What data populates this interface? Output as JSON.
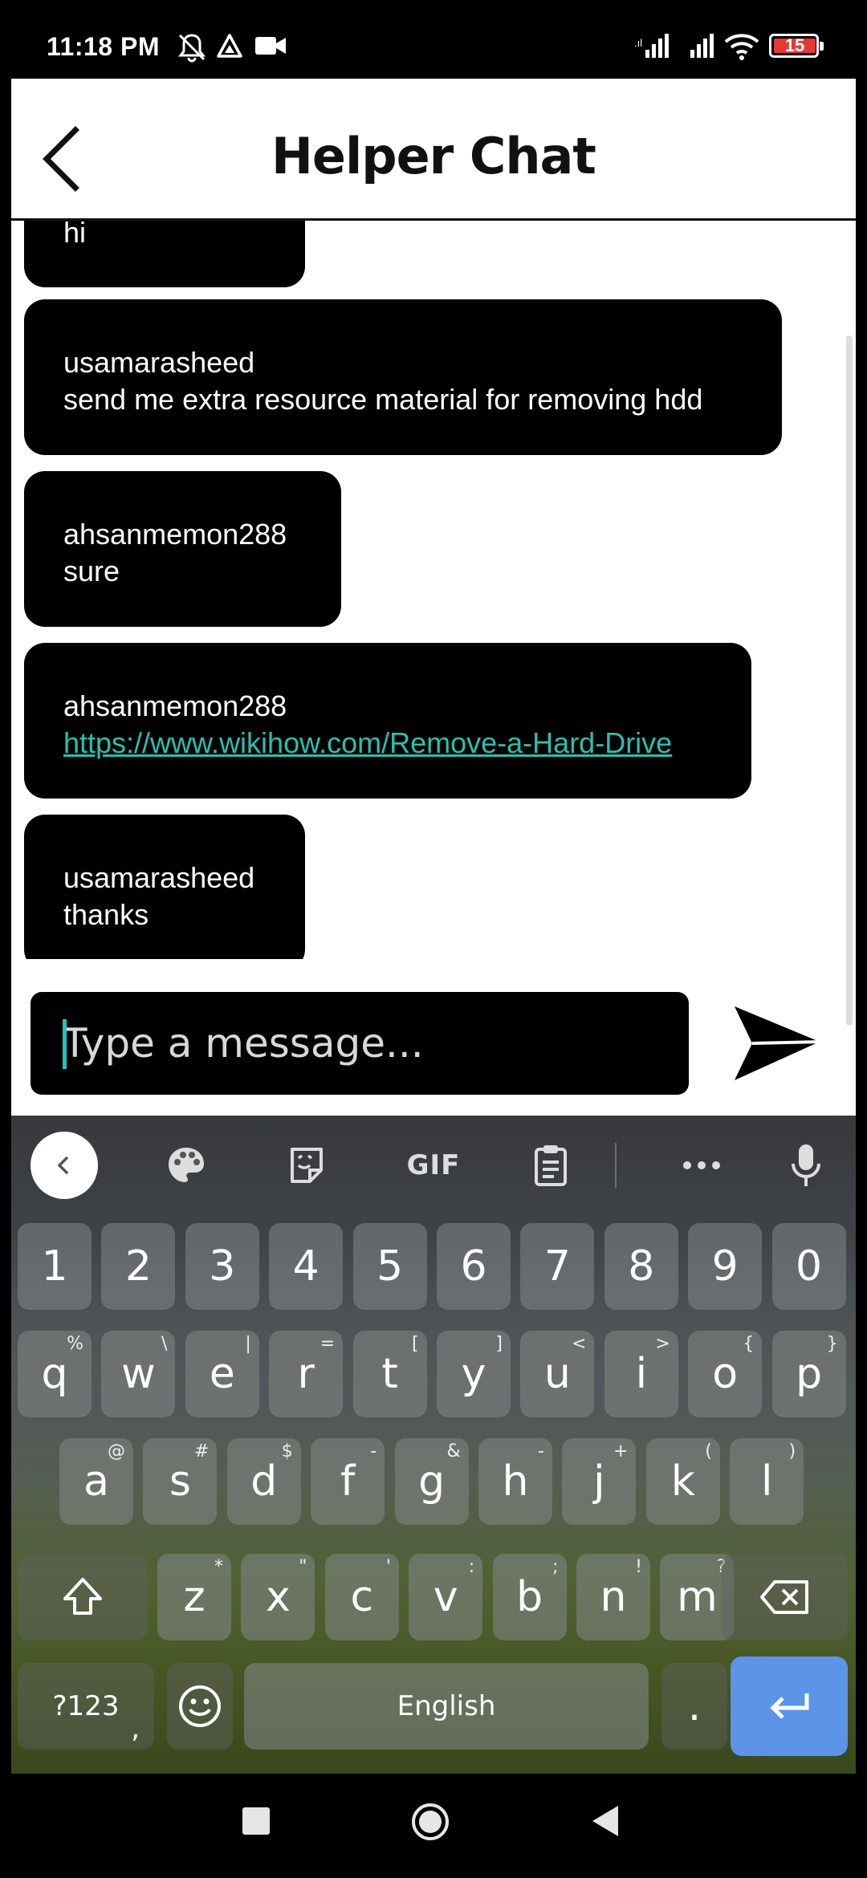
{
  "status_bar": {
    "time": "11:18 PM",
    "battery_level": "15",
    "icons": [
      "mute-icon",
      "drive-icon",
      "video-icon",
      "signal-icon",
      "signal-icon",
      "wifi-icon",
      "battery-icon"
    ]
  },
  "header": {
    "title": "Helper Chat",
    "back_icon": "chevron-left-icon"
  },
  "messages": [
    {
      "sender": "",
      "text": "hi",
      "link": false
    },
    {
      "sender": "usamarasheed",
      "text": "send me extra resource material for removing hdd",
      "link": false
    },
    {
      "sender": "ahsanmemon288",
      "text": "sure",
      "link": false
    },
    {
      "sender": "ahsanmemon288",
      "text": "https://www.wikihow.com/Remove-a-Hard-Drive",
      "link": true
    },
    {
      "sender": "usamarasheed",
      "text": "thanks",
      "link": false
    }
  ],
  "composer": {
    "placeholder": "Type a message...",
    "value": "",
    "send_icon": "send-icon"
  },
  "keyboard": {
    "toolbar": {
      "icons": [
        "chevron-left-icon",
        "palette-icon",
        "sticker-icon",
        "gif-icon",
        "clipboard-icon",
        "more-icon",
        "mic-icon"
      ],
      "gif_label": "GIF"
    },
    "number_row": [
      "1",
      "2",
      "3",
      "4",
      "5",
      "6",
      "7",
      "8",
      "9",
      "0"
    ],
    "row1": [
      {
        "k": "q",
        "h": "%"
      },
      {
        "k": "w",
        "h": "\\"
      },
      {
        "k": "e",
        "h": "|"
      },
      {
        "k": "r",
        "h": "="
      },
      {
        "k": "t",
        "h": "["
      },
      {
        "k": "y",
        "h": "]"
      },
      {
        "k": "u",
        "h": "<"
      },
      {
        "k": "i",
        "h": ">"
      },
      {
        "k": "o",
        "h": "{"
      },
      {
        "k": "p",
        "h": "}"
      }
    ],
    "row2": [
      {
        "k": "a",
        "h": "@"
      },
      {
        "k": "s",
        "h": "#"
      },
      {
        "k": "d",
        "h": "$"
      },
      {
        "k": "f",
        "h": "-"
      },
      {
        "k": "g",
        "h": "&"
      },
      {
        "k": "h",
        "h": "-"
      },
      {
        "k": "j",
        "h": "+"
      },
      {
        "k": "k",
        "h": "("
      },
      {
        "k": "l",
        "h": ")"
      }
    ],
    "row3": [
      {
        "k": "z",
        "h": "*"
      },
      {
        "k": "x",
        "h": "\""
      },
      {
        "k": "c",
        "h": "'"
      },
      {
        "k": "v",
        "h": ":"
      },
      {
        "k": "b",
        "h": ";"
      },
      {
        "k": "n",
        "h": "!"
      },
      {
        "k": "m",
        "h": "?"
      }
    ],
    "symbols_label": "?123",
    "comma": ",",
    "space_label": "English",
    "period": ".",
    "shift_icon": "shift-icon",
    "backspace_icon": "backspace-icon",
    "emoji_icon": "emoji-icon",
    "enter_icon": "enter-icon",
    "enter_color": "#5c94e8"
  },
  "nav_bar": {
    "icons": [
      "recents-icon",
      "home-icon",
      "back-icon"
    ]
  }
}
